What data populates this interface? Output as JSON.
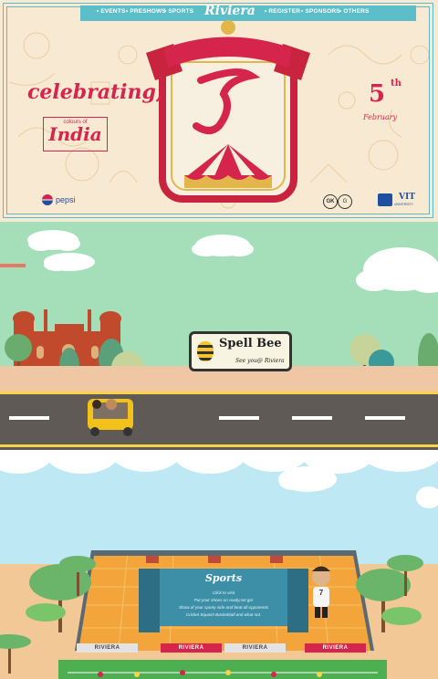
{
  "nav": {
    "items": [
      "EVENTS",
      "PRESHOWS",
      "SPORTS",
      "REGISTER",
      "SPONSORS",
      "OTHERS"
    ],
    "brand": "Riviera"
  },
  "hero": {
    "celebrating": "celebrating,",
    "colours_of": "colours of",
    "india": "India",
    "date_day": "5",
    "date_sup": "th",
    "date_month": "February",
    "pepsi": "pepsi",
    "vit": "VIT",
    "vit_sub": "UNIVERSITY"
  },
  "road": {
    "sign_title": "Spell Bee",
    "sign_subtitle": "See you@ Riviera"
  },
  "sports": {
    "title": "Sports",
    "lines": [
      "Click to visit",
      "Put your shoes on ready,set go!",
      "Show of your sporty side and beat all opponents",
      "Cricket Squash Basketball and what not."
    ],
    "banner": "RIVIERA",
    "player_number": "7"
  },
  "colors": {
    "accent": "#d6254c",
    "nav": "#5bbec9",
    "sky_green": "#a4dfb9",
    "sky_blue": "#bfe8f5"
  }
}
